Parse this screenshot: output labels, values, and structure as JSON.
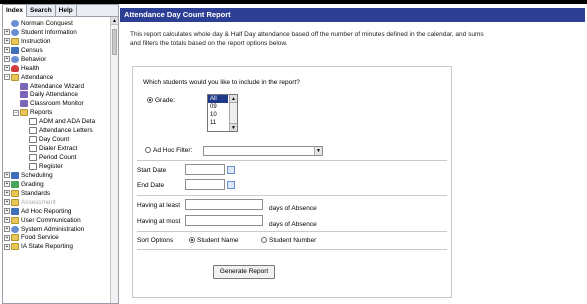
{
  "tabs": [
    "Index",
    "Search",
    "Help"
  ],
  "tree": [
    {
      "label": "Norman Conquest",
      "level": 0,
      "exp": "",
      "icon": "people"
    },
    {
      "label": "Student Information",
      "level": 0,
      "exp": "+",
      "icon": "people"
    },
    {
      "label": "Instruction",
      "level": 0,
      "exp": "+",
      "icon": "folder"
    },
    {
      "label": "Census",
      "level": 0,
      "exp": "+",
      "icon": "blue"
    },
    {
      "label": "Behavior",
      "level": 0,
      "exp": "+",
      "icon": "people"
    },
    {
      "label": "Health",
      "level": 0,
      "exp": "+",
      "icon": "heart"
    },
    {
      "label": "Attendance",
      "level": 0,
      "exp": "−",
      "icon": "folder"
    },
    {
      "label": "Attendance Wizard",
      "level": 1,
      "exp": "",
      "icon": "wand"
    },
    {
      "label": "Daily Attendance",
      "level": 1,
      "exp": "",
      "icon": "wand"
    },
    {
      "label": "Classroom Monitor",
      "level": 1,
      "exp": "",
      "icon": "wand"
    },
    {
      "label": "Reports",
      "level": 1,
      "exp": "−",
      "icon": "folder"
    },
    {
      "label": "ADM and ADA Deta",
      "level": 2,
      "exp": "",
      "icon": "doc"
    },
    {
      "label": "Attendance Letters",
      "level": 2,
      "exp": "",
      "icon": "doc"
    },
    {
      "label": "Day Count",
      "level": 2,
      "exp": "",
      "icon": "doc"
    },
    {
      "label": "Dialer Extract",
      "level": 2,
      "exp": "",
      "icon": "doc"
    },
    {
      "label": "Period Count",
      "level": 2,
      "exp": "",
      "icon": "doc"
    },
    {
      "label": "Register",
      "level": 2,
      "exp": "",
      "icon": "doc"
    },
    {
      "label": "Scheduling",
      "level": 0,
      "exp": "+",
      "icon": "blue"
    },
    {
      "label": "Grading",
      "level": 0,
      "exp": "+",
      "icon": "green"
    },
    {
      "label": "Standards",
      "level": 0,
      "exp": "+",
      "icon": "folder"
    },
    {
      "label": "Assessment",
      "level": 0,
      "exp": "+",
      "icon": "folder",
      "grey": true
    },
    {
      "label": "Ad Hoc Reporting",
      "level": 0,
      "exp": "+",
      "icon": "blue"
    },
    {
      "label": "User Communication",
      "level": 0,
      "exp": "+",
      "icon": "folder"
    },
    {
      "label": "System Administration",
      "level": 0,
      "exp": "+",
      "icon": "people"
    },
    {
      "label": "Food Service",
      "level": 0,
      "exp": "+",
      "icon": "folder"
    },
    {
      "label": "IA State Reporting",
      "level": 0,
      "exp": "+",
      "icon": "folder"
    }
  ],
  "page": {
    "title": "Attendance Day Count Report",
    "description": "This report calculates whole day & Half Day attendance based off the number of minutes defined in the calendar, and sums and filters the totals based on the report options below."
  },
  "form": {
    "question": "Which students would you like to include in the report?",
    "grade_label": "Grade:",
    "grade_options": [
      "All",
      "09",
      "10",
      "11"
    ],
    "adhoc_label": "Ad Hoc Filter:",
    "start_date_label": "Start Date",
    "end_date_label": "End Date",
    "at_least_label": "Having at least",
    "at_least_suffix": "days of Absence",
    "at_most_label": "Having at most",
    "at_most_suffix": "days of Absence",
    "sort_label": "Sort Options",
    "sort_name": "Student Name",
    "sort_number": "Student Number",
    "generate_button": "Generate Report"
  }
}
